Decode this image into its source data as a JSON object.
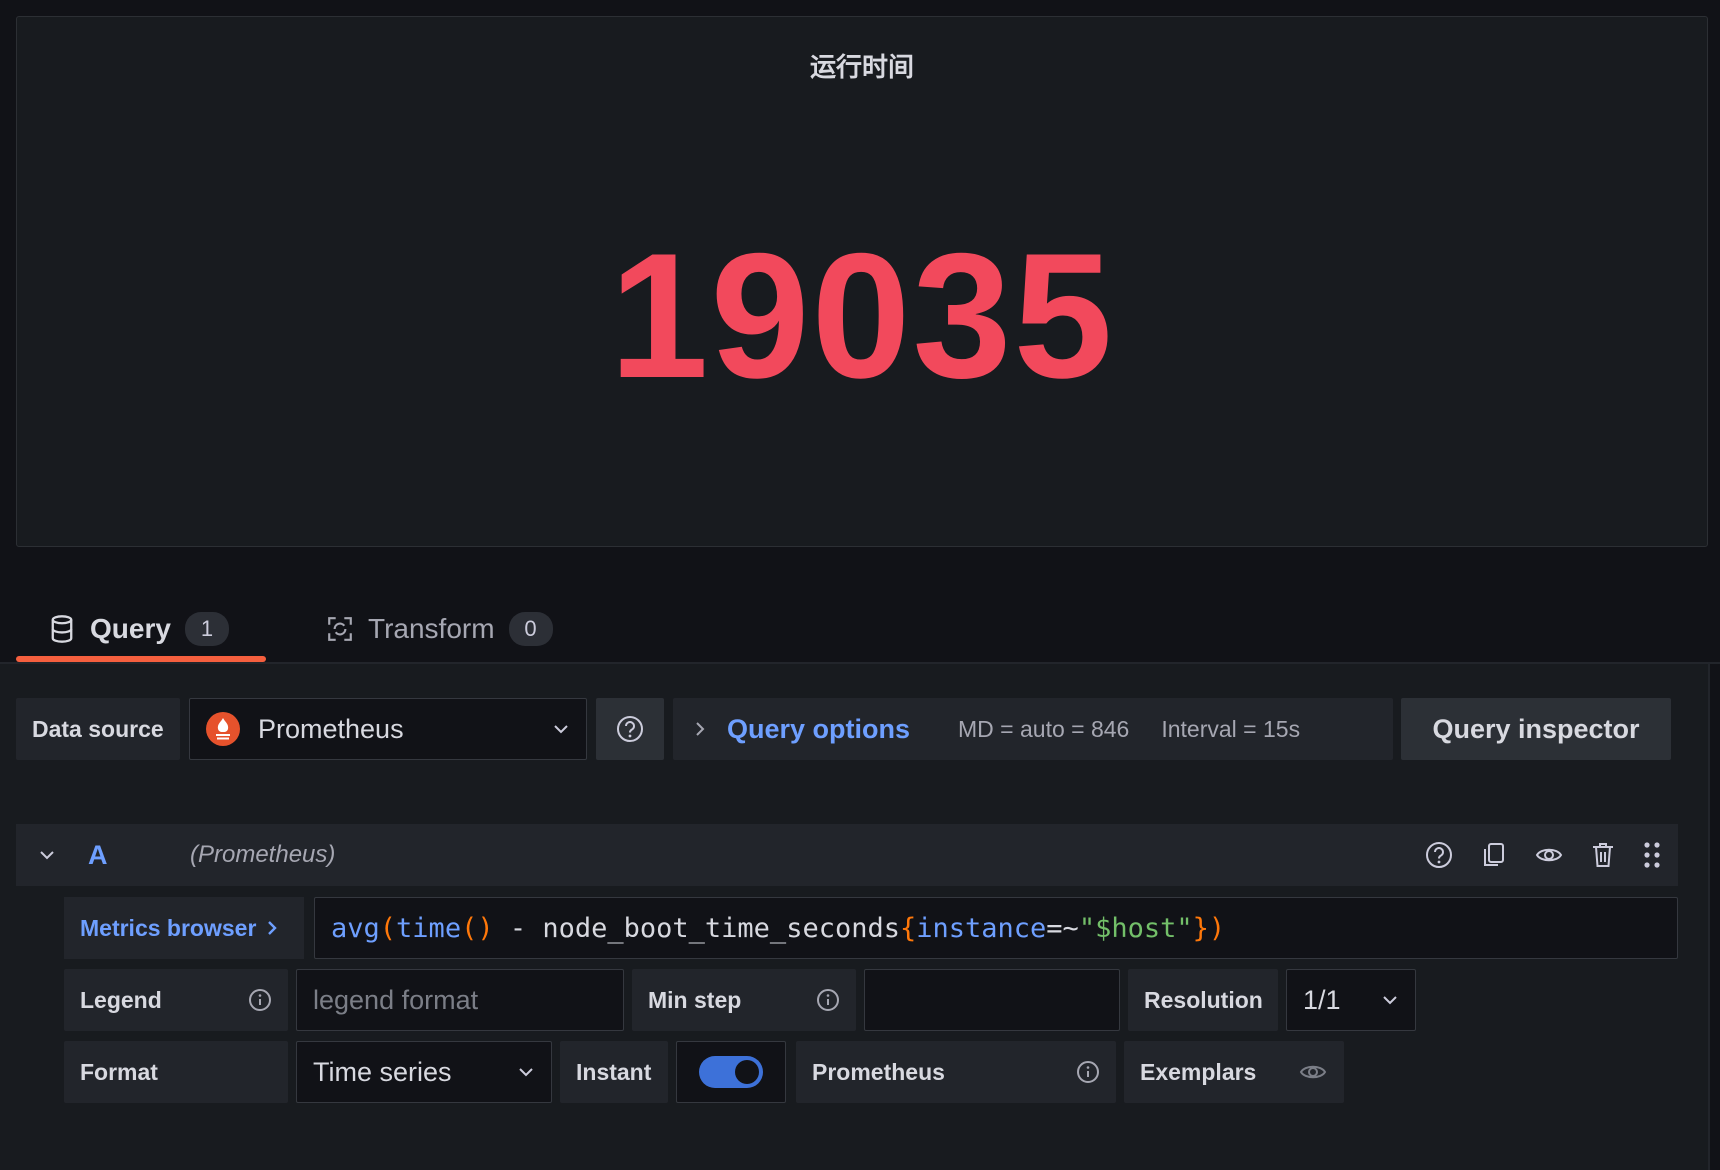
{
  "panel": {
    "title": "运行时间",
    "value": "19035",
    "value_color": "#f2495c"
  },
  "tabs": [
    {
      "label": "Query",
      "count": "1",
      "icon": "database-icon",
      "active": true
    },
    {
      "label": "Transform",
      "count": "0",
      "icon": "transform-icon",
      "active": false
    }
  ],
  "toolbar": {
    "data_source_label": "Data source",
    "data_source_value": "Prometheus",
    "query_options_label": "Query options",
    "md_text": "MD = auto = 846",
    "interval_text": "Interval = 15s",
    "query_inspector_label": "Query inspector"
  },
  "query": {
    "ref_id": "A",
    "datasource_hint": "(Prometheus)",
    "metrics_browser_label": "Metrics browser",
    "expr_tokens": [
      {
        "t": "avg",
        "c": "c-fn"
      },
      {
        "t": "(",
        "c": "c-paren"
      },
      {
        "t": "time",
        "c": "c-fn"
      },
      {
        "t": "()",
        "c": "c-paren"
      },
      {
        "t": " - node_boot_time_seconds",
        "c": "c-txt"
      },
      {
        "t": "{",
        "c": "c-paren"
      },
      {
        "t": "instance",
        "c": "c-fn"
      },
      {
        "t": "=~",
        "c": "c-txt"
      },
      {
        "t": "\"$host\"",
        "c": "c-str"
      },
      {
        "t": "}",
        "c": "c-paren"
      },
      {
        "t": ")",
        "c": "c-paren"
      }
    ],
    "legend_label": "Legend",
    "legend_placeholder": "legend format",
    "min_step_label": "Min step",
    "min_step_value": "",
    "resolution_label": "Resolution",
    "resolution_value": "1/1",
    "format_label": "Format",
    "format_value": "Time series",
    "instant_label": "Instant",
    "instant_on": true,
    "type_label": "Prometheus",
    "exemplars_label": "Exemplars"
  },
  "colors": {
    "accent": "#6e9fff",
    "tab_underline": "#f55f3e",
    "prometheus_logo": "#e6522c"
  }
}
